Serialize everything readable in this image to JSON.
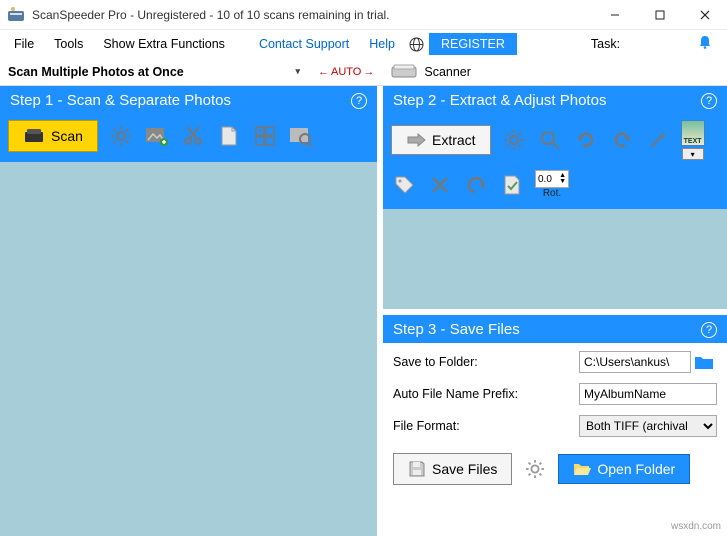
{
  "window": {
    "title": "ScanSpeeder Pro - Unregistered - 10 of 10 scans remaining in trial."
  },
  "menu": {
    "file": "File",
    "tools": "Tools",
    "extra": "Show Extra Functions",
    "contact": "Contact Support",
    "help": "Help",
    "register": "REGISTER",
    "task": "Task:"
  },
  "modebar": {
    "mode": "Scan Multiple Photos at Once",
    "auto_left": "←",
    "auto": "AUTO",
    "auto_right": "→",
    "scanner": "Scanner"
  },
  "step1": {
    "title": "Step 1 - Scan & Separate Photos",
    "scan": "Scan"
  },
  "step2": {
    "title": "Step 2 - Extract & Adjust Photos",
    "extract": "Extract",
    "rot_val": "0.0",
    "rot_lbl": "Rot.",
    "text_flag": "TEXT"
  },
  "step3": {
    "title": "Step 3 - Save Files",
    "save_to": "Save to Folder:",
    "folder": "C:\\Users\\ankus\\",
    "prefix_lbl": "Auto File Name Prefix:",
    "prefix": "MyAlbumName",
    "format_lbl": "File Format:",
    "format": "Both TIFF (archival",
    "save_files": "Save Files",
    "open_folder": "Open Folder"
  },
  "watermark": "wsxdn.com"
}
